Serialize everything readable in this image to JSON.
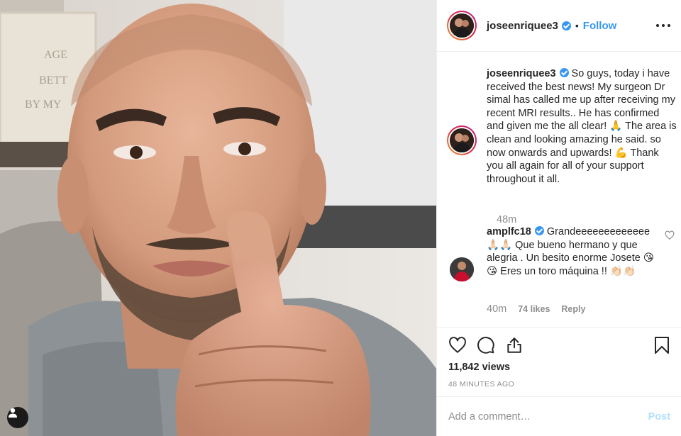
{
  "post": {
    "username": "joseenriquee3",
    "follow_label": "Follow",
    "dot_separator": "•",
    "more_options_icon": "more-horizontal-icon"
  },
  "caption": {
    "username": "joseenriquee3",
    "text": "So guys, today i have received the best news! My surgeon Dr simal has called me up after receiving my recent MRI results.. He has confirmed and given me the all clear! 🙏  The area is clean and looking amazing he said. so now onwards and upwards! 💪  Thank you all again for all of your support throughout it all.",
    "time": "48m"
  },
  "comment": {
    "username": "amplfc18",
    "text": "Grandeeeeeeeeeeeee 🙏🏻🙏🏻 Que bueno hermano y que alegria . Un besito enorme Josete 😘 😘  Eres un toro máquina !! 👏🏻👏🏻",
    "time": "40m",
    "likes": "74 likes",
    "reply_label": "Reply"
  },
  "stats": {
    "views": "11,842 views",
    "timestamp": "48 MINUTES AGO"
  },
  "add_comment": {
    "placeholder": "Add a comment…",
    "post_label": "Post"
  },
  "colors": {
    "link_blue": "#3897f0",
    "muted_gray": "#8e8e8e",
    "post_disabled": "#b2dffc"
  }
}
